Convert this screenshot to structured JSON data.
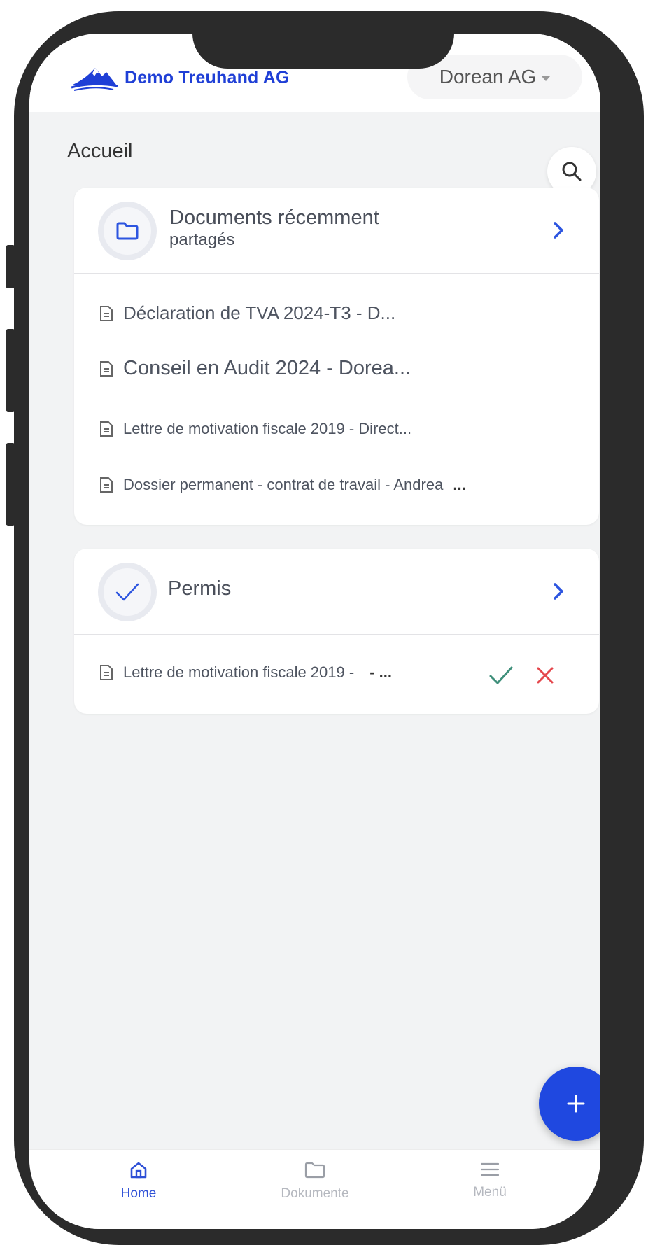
{
  "app": {
    "brand": "Demo Treuhand AG",
    "company_selector": "Dorean AG"
  },
  "page": {
    "title": "Accueil"
  },
  "recent_documents": {
    "title": "Documents récemment",
    "subtitle": "partagés",
    "items": [
      {
        "label": "Déclaration de TVA 2024-T3 - D..."
      },
      {
        "label": "Conseil en Audit 2024 - Dorea..."
      },
      {
        "label": "Lettre de motivation fiscale 2019 - Direct..."
      },
      {
        "label": "Dossier permanent - contrat de travail - Andrea",
        "more": "..."
      }
    ]
  },
  "permits": {
    "title": "Permis",
    "items": [
      {
        "label": "Lettre de motivation fiscale 2019 -",
        "suffix": "- ..."
      }
    ]
  },
  "bottom_nav": {
    "items": [
      {
        "label": "Home",
        "icon": "home-icon",
        "active": true
      },
      {
        "label": "Dokumente",
        "icon": "folder-icon",
        "active": false
      },
      {
        "label": "Menü",
        "icon": "menu-icon",
        "active": false
      }
    ]
  },
  "colors": {
    "brand_blue": "#1f3fd6",
    "fab_blue": "#1f48e0",
    "approve_green": "#3e8f7a",
    "reject_red": "#e5484d",
    "chevron_blue": "#2d55e0"
  }
}
